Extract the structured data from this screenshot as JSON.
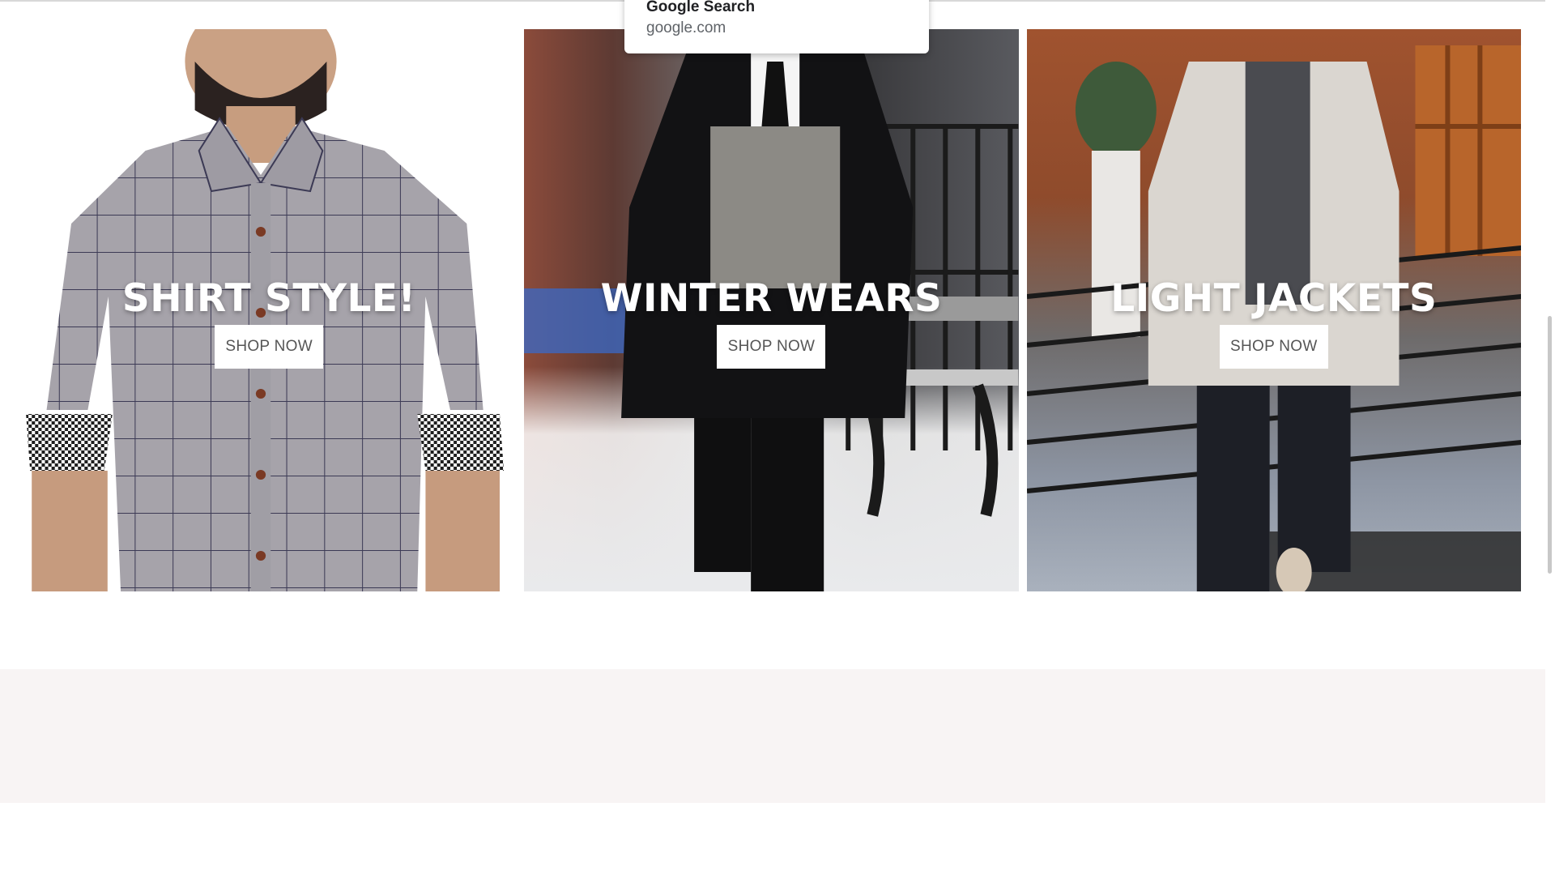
{
  "autocomplete": {
    "title": "Google Search",
    "url": "google.com"
  },
  "banners": [
    {
      "title": "SHIRT STYLE!",
      "button": "SHOP NOW"
    },
    {
      "title": "WINTER WEARS",
      "button": "SHOP NOW"
    },
    {
      "title": "LIGHT JACKETS",
      "button": "SHOP NOW"
    }
  ],
  "colors": {
    "banner_text": "#ffffff",
    "button_bg": "#ffffff",
    "button_text": "#555555",
    "footer_band": "#f8f4f4"
  },
  "icons": [
    "scrollbar-thumb"
  ]
}
